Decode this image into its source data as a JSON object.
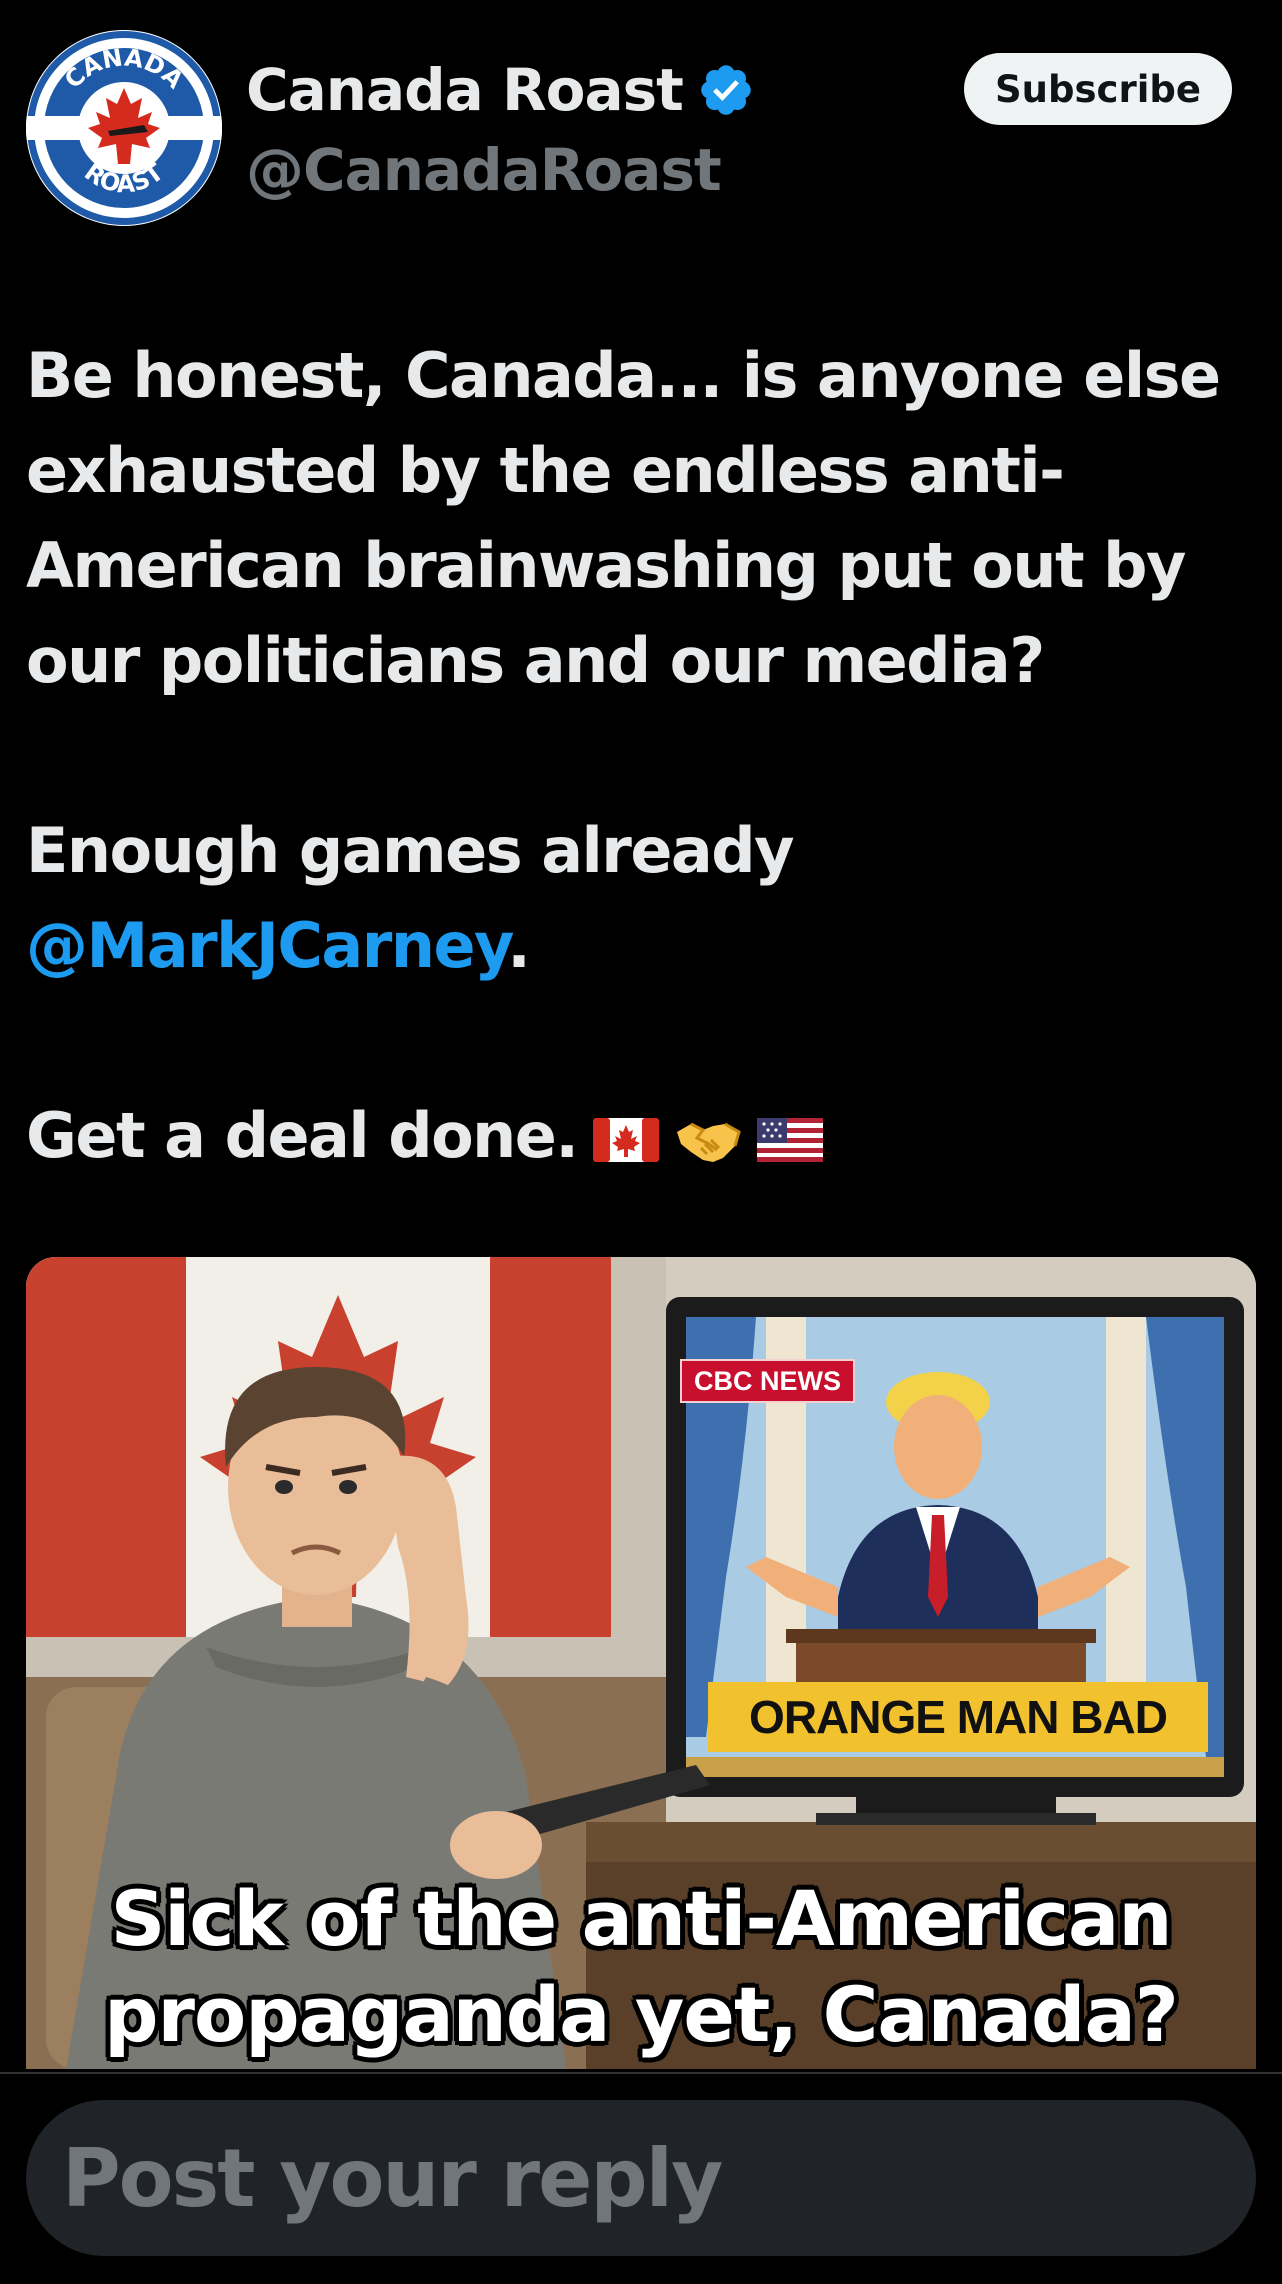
{
  "account": {
    "display_name": "Canada Roast",
    "handle": "@CanadaRoast",
    "verified": true,
    "avatar_text_top": "CANADA",
    "avatar_text_bottom": "ROAST",
    "subscribe_label": "Subscribe"
  },
  "tweet": {
    "line1": "Be honest, Canada... is anyone else exhausted by the endless anti-American brainwashing put out by our politicians and our media?",
    "line2_prefix": "Enough games already ",
    "mention": "@MarkJCarney",
    "line2_suffix": ".",
    "line3": "Get a deal done.",
    "emojis": [
      "canada-flag-icon",
      "handshake-icon",
      "us-flag-icon"
    ]
  },
  "media": {
    "tv_badge": "CBC NEWS",
    "tv_ticker": "ORANGE MAN BAD",
    "caption_line1": "Sick of the anti-American",
    "caption_line2": "propaganda yet, Canada?"
  },
  "reply": {
    "placeholder": "Post your reply"
  },
  "colors": {
    "background": "#000000",
    "text": "#e7e9ea",
    "secondary_text": "#71767b",
    "link": "#1d9bf0",
    "verified": "#1d9bf0",
    "reply_field": "#202327"
  }
}
